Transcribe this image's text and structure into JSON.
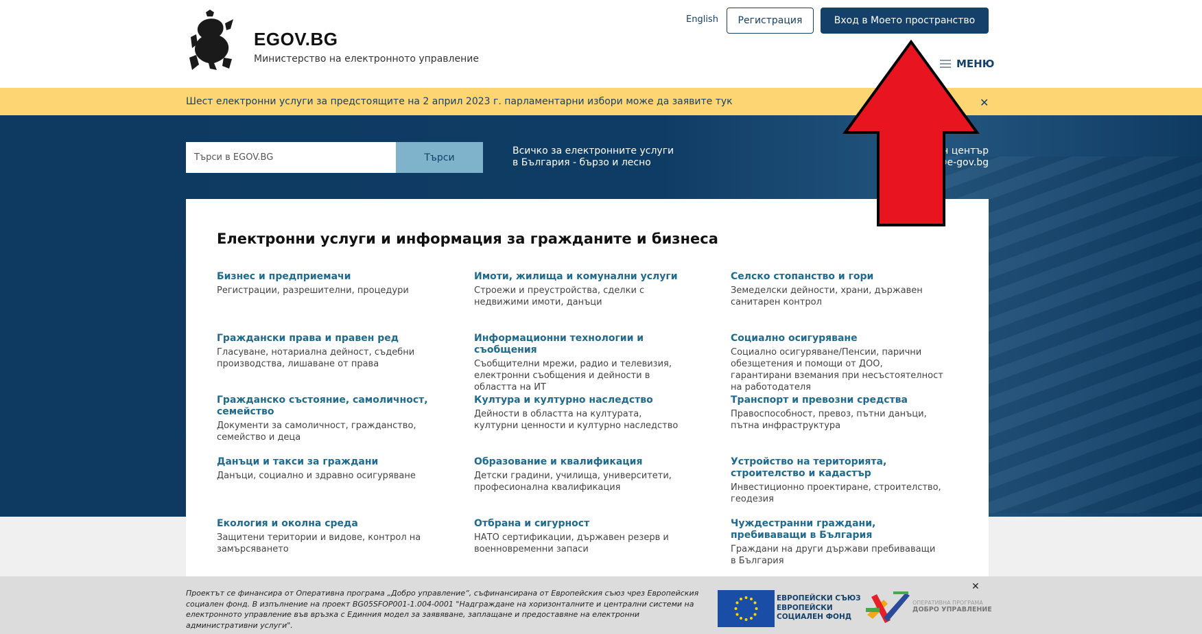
{
  "header": {
    "brand_title": "EGOV.BG",
    "brand_subtitle": "Министерство на електронното управление",
    "language_link": "English",
    "register_button": "Регистрация",
    "login_button": "Вход в Моето пространство",
    "menu_label": "МЕНЮ"
  },
  "announcement": {
    "text": "Шест електронни услуги за предстоящите на 2 април 2023 г. парламентарни избори може да заявите тук",
    "close_icon": "close-icon"
  },
  "hero": {
    "search_placeholder": "Търси в EGOV.BG",
    "search_button": "Търси",
    "tagline": "Всичко за електронните услуги в България - бързо и лесно",
    "help_title": "Помощен център",
    "help_contact": "0700 … @e-gov.bg"
  },
  "services": {
    "title": "Електронни услуги и информация за гражданите и бизнеса",
    "items": [
      {
        "title": "Бизнес и предприемачи",
        "desc": "Регистрации, разрешителни, процедури"
      },
      {
        "title": "Имоти, жилища и комунални услуги",
        "desc": "Строежи и преустройства, сделки с недвижими имоти, данъци"
      },
      {
        "title": "Селско стопанство и гори",
        "desc": "Земеделски дейности, храни, държавен санитарен контрол"
      },
      {
        "title": "Граждански права и правен ред",
        "desc": "Гласуване, нотариална дейност, съдебни производства, лишаване от права"
      },
      {
        "title": "Информационни технологии и съобщения",
        "desc": "Съобщителни мрежи, радио и телевизия, електронни съобщения и дейности в областта на ИТ"
      },
      {
        "title": "Социално осигуряване",
        "desc": "Социално осигуряване/Пенсии, парични обезщетения и помощи от ДОО, гарантирани вземания при несъстоятелност на работодателя"
      },
      {
        "title": "Гражданско състояние, самоличност, семейство",
        "desc": "Документи за самоличност, гражданство, семейство и деца"
      },
      {
        "title": "Култура и културно наследство",
        "desc": "Дейности в областта на културата, културни ценности и културно наследство"
      },
      {
        "title": "Транспорт и превозни средства",
        "desc": "Правоспособност, превоз, пътни данъци, пътна инфраструктура"
      },
      {
        "title": "Данъци и такси за граждани",
        "desc": "Данъци, социално и здравно осигуряване"
      },
      {
        "title": "Образование и квалификация",
        "desc": "Детски градини, училища, университети, професионална квалификация"
      },
      {
        "title": "Устройство на територията, строителство и кадастър",
        "desc": "Инвестиционно проектиране, строителство, геодезия"
      },
      {
        "title": "Екология и околна среда",
        "desc": "Защитени територии и видове, контрол на замърсяването"
      },
      {
        "title": "Отбрана и сигурност",
        "desc": "НАТО сертификации, държавен резерв и военновременни запаси"
      },
      {
        "title": "Чуждестранни граждани, пребиваващи в България",
        "desc": "Граждани на други държави пребиваващи в България"
      }
    ]
  },
  "funding": {
    "text": "Проектът се финансира от Оперативна програма „Добро управление“, съфинансирана от Европейския съюз чрез Европейския социален фонд. В изпълнение на проект BG05SFOP001-1.004-0001 \"Надграждане на хоризонталните и централни системи на електронното управление във връзка с Единния модел за заявяване, заплащане и предоставяне на електронни административни услуги\".",
    "eu_label": "Европейски съюз Европейски социален фонд",
    "op_label_small": "Оперативна програма",
    "op_label": "Добро управление"
  },
  "colors": {
    "primary": "#14406a",
    "accent_link": "#1f6a8e",
    "announcement_bg": "#fdd573",
    "search_button_bg": "#7fb3cb",
    "arrow": "#e8141f"
  }
}
